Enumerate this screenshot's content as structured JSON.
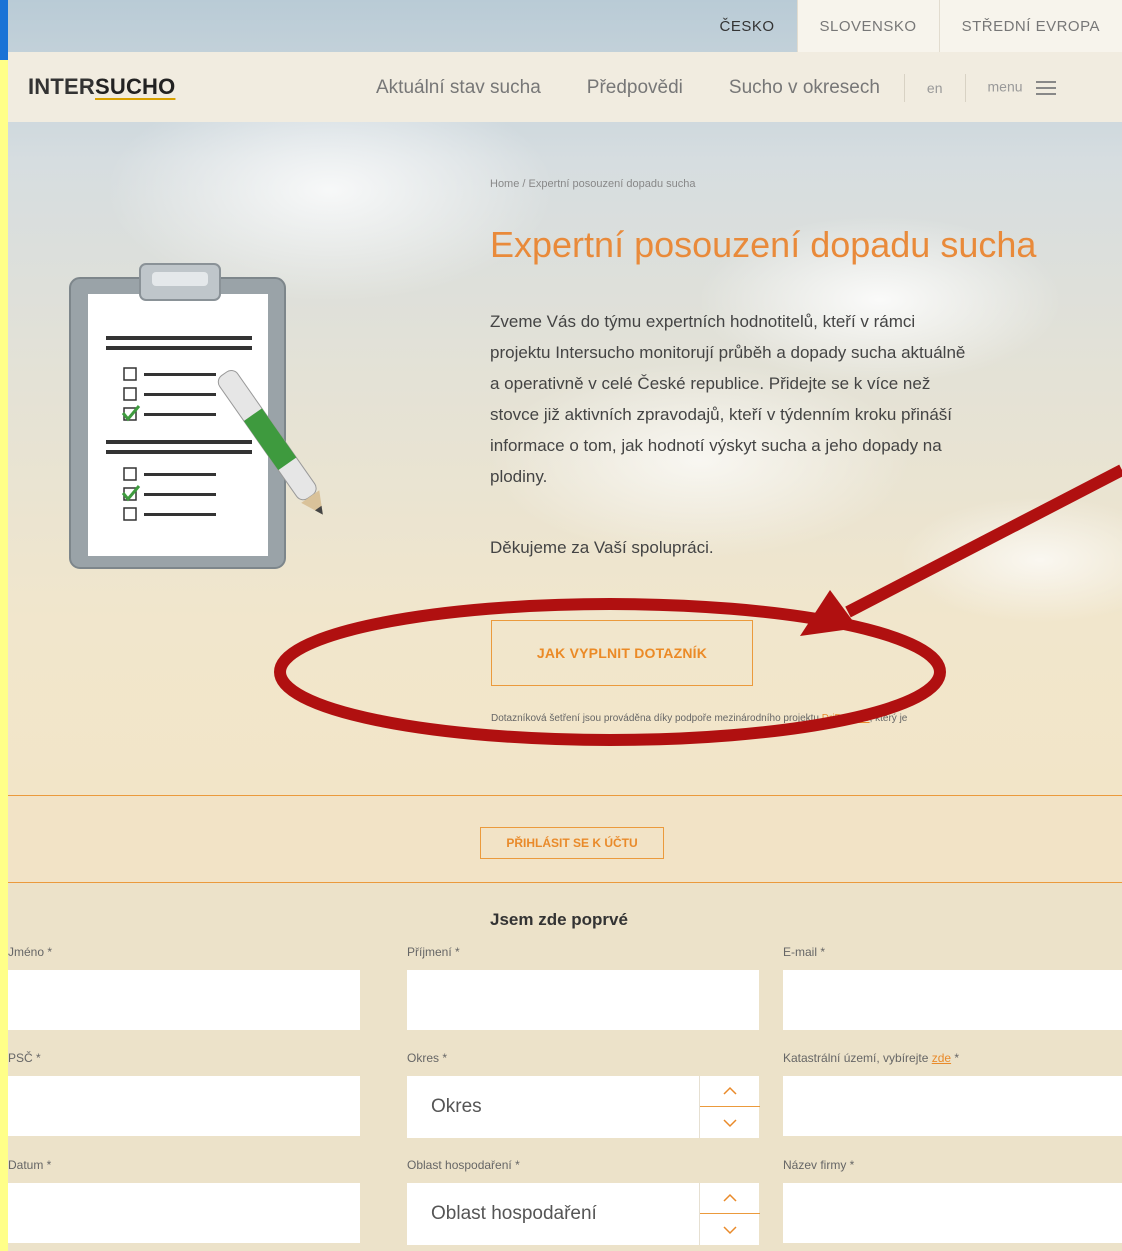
{
  "country_tabs": [
    "ČESKO",
    "SLOVENSKO",
    "STŘEDNÍ EVROPA"
  ],
  "logo": {
    "part1": "INTER",
    "part2": "SUCHO"
  },
  "nav": {
    "items": [
      "Aktuální stav sucha",
      "Předpovědi",
      "Sucho v okresech"
    ],
    "lang": "en",
    "menu": "menu"
  },
  "breadcrumb": "Home / Expertní posouzení dopadu sucha",
  "page_title": "Expertní posouzení dopadu sucha",
  "intro_lines": [
    "Zveme Vás do týmu expertních hodnotitelů, kteří v rámci",
    "projektu Intersucho monitorují průběh a dopady sucha aktuálně",
    "a operativně v celé České republice. Přidejte se k více než",
    "stovce již aktivních zpravodajů, kteří v týdenním kroku přináší",
    "informace o tom, jak hodnotí výskyt sucha a jeho dopady na",
    "plodiny."
  ],
  "thanks": "Děkujeme za Vaší spolupráci.",
  "cta_label": "JAK VYPLNIT DOTAZNÍK",
  "footnote": {
    "before": "Dotazníková šetření jsou prováděna díky podpoře mezinárodního projektu ",
    "link": "DriDanube",
    "after": ", který je"
  },
  "login_label": "PŘIHLÁSIT SE K ÚČTU",
  "form": {
    "heading": "Jsem zde poprvé",
    "fields": {
      "jmeno": "Jméno *",
      "prijmeni": "Příjmení *",
      "email": "E-mail *",
      "psc": "PSČ *",
      "okres": "Okres *",
      "katastr_prefix": "Katastrální území, vybírejte ",
      "katastr_link": "zde",
      "katastr_suffix": " *",
      "datum": "Datum *",
      "oblast": "Oblast hospodaření *",
      "firma": "Název firmy *"
    },
    "selects": {
      "okres": "Okres",
      "oblast": "Oblast hospodaření"
    }
  },
  "colors": {
    "accent": "#eb9a3c",
    "annotation": "#b01010",
    "title": "#e98a3a"
  }
}
